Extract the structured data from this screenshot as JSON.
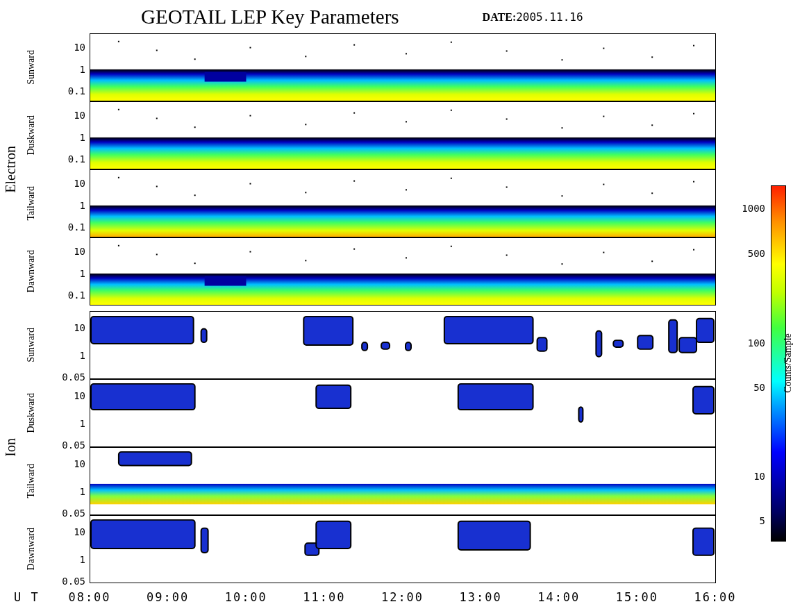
{
  "title": "GEOTAIL LEP Key Parameters",
  "date_label": "DATE:",
  "date": "2005.11.16",
  "groups": [
    {
      "label": "Electron",
      "panels": [
        {
          "label": "Sunward",
          "kind": "electron",
          "yticks": [
            "10",
            "1",
            "0.1"
          ]
        },
        {
          "label": "Duskward",
          "kind": "electron",
          "yticks": [
            "10",
            "1",
            "0.1"
          ]
        },
        {
          "label": "Tailward",
          "kind": "electron",
          "yticks": [
            "10",
            "1",
            "0.1"
          ]
        },
        {
          "label": "Dawnward",
          "kind": "electron",
          "yticks": [
            "10",
            "1",
            "0.1"
          ]
        }
      ]
    },
    {
      "label": "Ion",
      "panels": [
        {
          "label": "Sunward",
          "kind": "ion",
          "yticks": [
            "10",
            "1",
            "0.05"
          ]
        },
        {
          "label": "Duskward",
          "kind": "ion",
          "yticks": [
            "10",
            "1",
            "0.05"
          ]
        },
        {
          "label": "Tailward",
          "kind": "ion-band",
          "yticks": [
            "10",
            "1",
            "0.05"
          ]
        },
        {
          "label": "Dawnward",
          "kind": "ion",
          "yticks": [
            "10",
            "1",
            "0.05"
          ]
        }
      ]
    }
  ],
  "x_axis": {
    "label": "U T",
    "ticks": [
      "08:00",
      "09:00",
      "10:00",
      "11:00",
      "12:00",
      "13:00",
      "14:00",
      "15:00",
      "16:00"
    ]
  },
  "colorbar": {
    "label": "Counts/Sample",
    "ticks": [
      "1000",
      "500",
      "100",
      "50",
      "10",
      "5"
    ]
  }
}
